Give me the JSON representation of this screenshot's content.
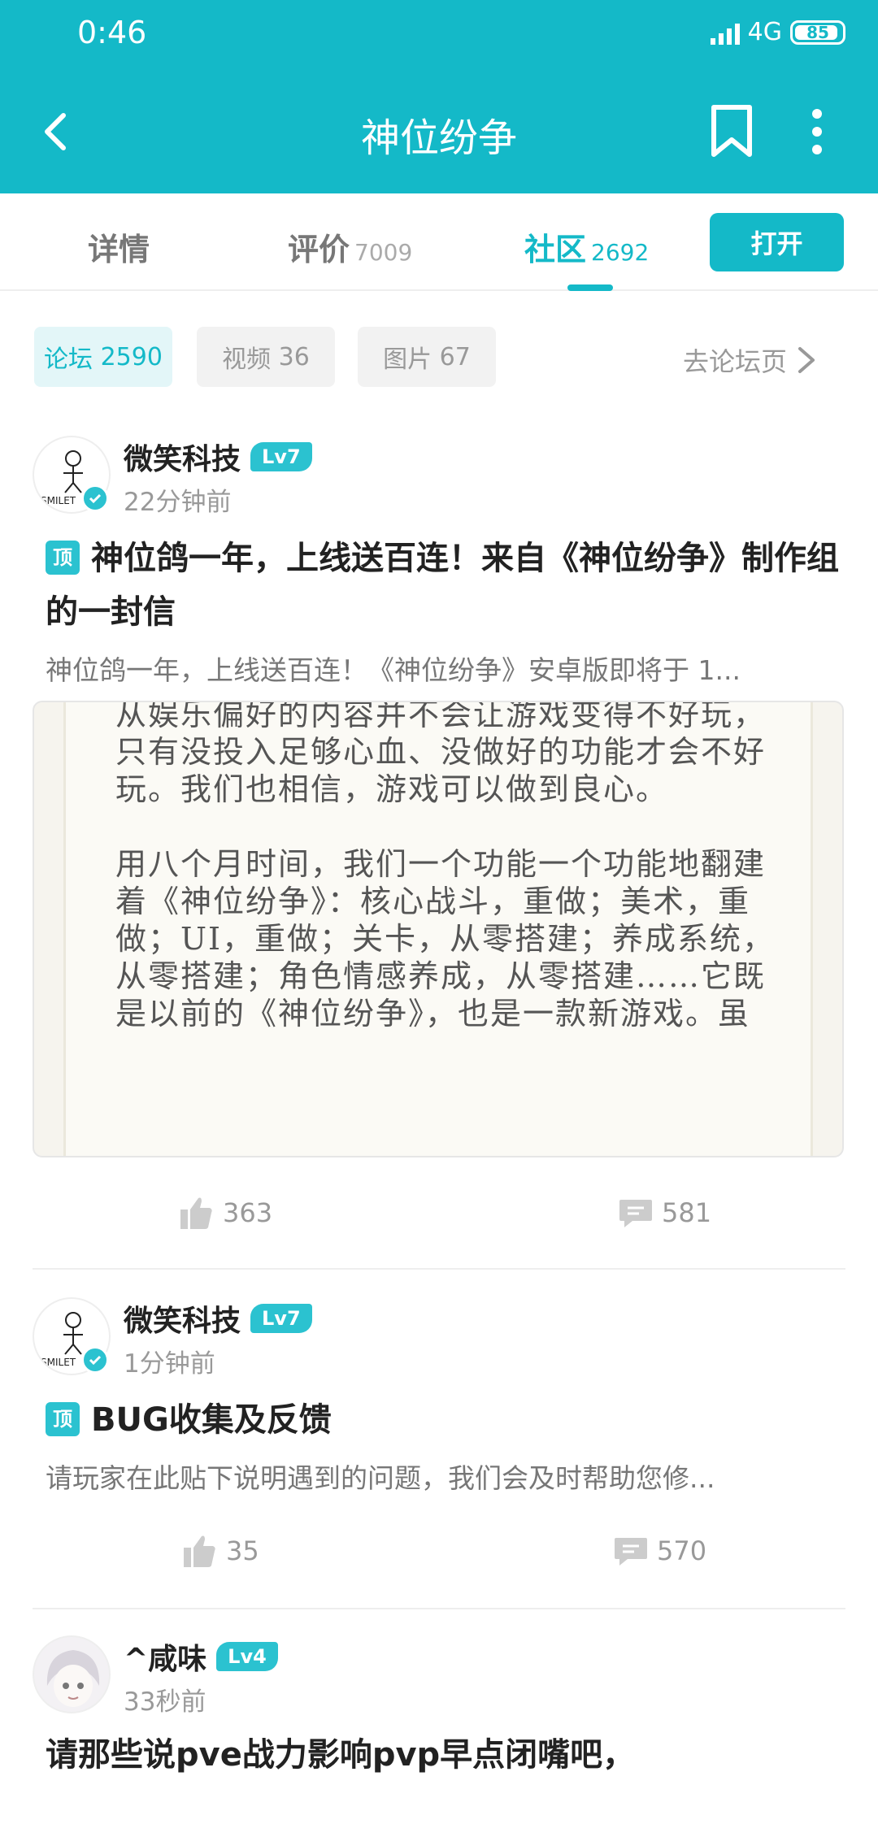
{
  "status_bar": {
    "time": "0:46",
    "network": "4G",
    "battery": "85"
  },
  "header": {
    "title": "神位纷争"
  },
  "tabs": [
    {
      "label": "详情",
      "count": ""
    },
    {
      "label": "评价",
      "count": "7009"
    },
    {
      "label": "社区",
      "count": "2692"
    }
  ],
  "open_button": "打开",
  "chips": [
    {
      "label": "论坛",
      "count": "2590"
    },
    {
      "label": "视频",
      "count": "36"
    },
    {
      "label": "图片",
      "count": "67"
    }
  ],
  "forum_link": "去论坛页",
  "posts": [
    {
      "author": "微笑科技",
      "level": "Lv7",
      "time": "22分钟前",
      "pin": "顶",
      "title": "神位鸽一年，上线送百连！来自《神位纷争》制作组的一封信",
      "snippet": "神位鸽一年，上线送百连！《神位纷争》安卓版即将于 1...",
      "likes": "363",
      "comments": "581",
      "image_lines": [
        "从娱乐偏好的内容并不会让游戏变得不好玩，",
        "只有没投入足够心血、没做好的功能才会不好",
        "玩。我们也相信，游戏可以做到良心。",
        "用八个月时间，我们一个功能一个功能地翻建",
        "着《神位纷争》：核心战斗，重做；美术，重",
        "做；UI，重做；关卡，从零搭建；养成系统，",
        "从零搭建；角色情感养成，从零搭建……它既",
        "是以前的《神位纷争》，也是一款新游戏。虽"
      ]
    },
    {
      "author": "微笑科技",
      "level": "Lv7",
      "time": "1分钟前",
      "pin": "顶",
      "title": "BUG收集及反馈",
      "snippet": "请玩家在此贴下说明遇到的问题，我们会及时帮助您修...",
      "likes": "35",
      "comments": "570"
    },
    {
      "author": "^咸味",
      "level": "Lv4",
      "time": "33秒前",
      "title": "请那些说pve战力影响pvp早点闭嘴吧，"
    }
  ]
}
